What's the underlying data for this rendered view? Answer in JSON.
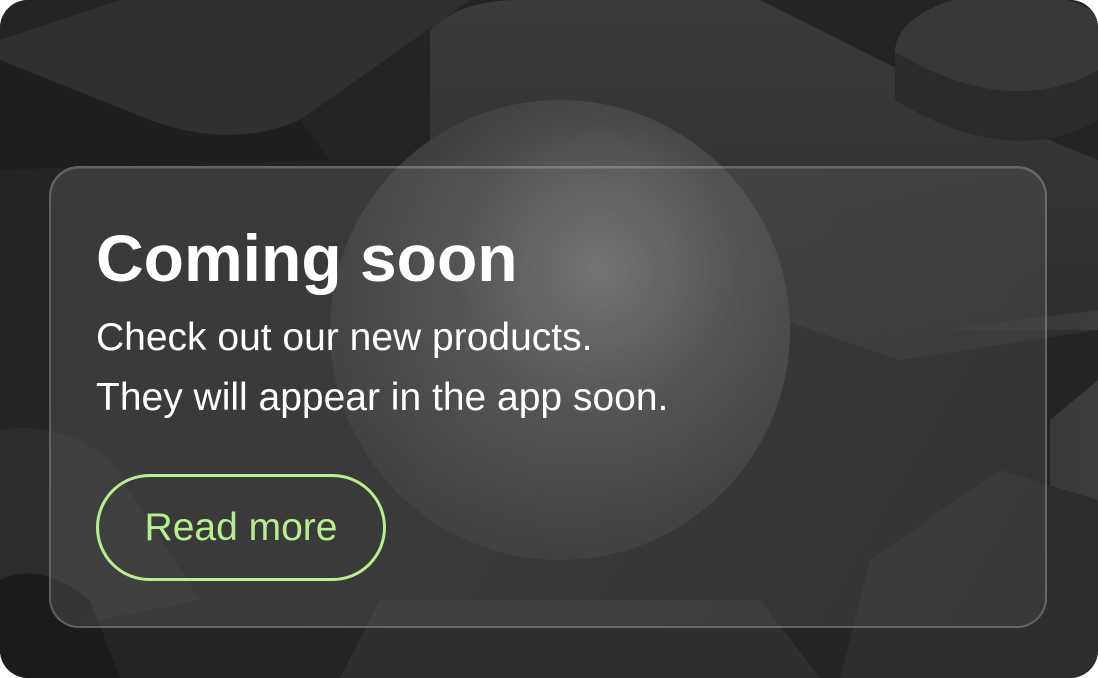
{
  "card": {
    "title": "Coming soon",
    "description_lines": [
      "Check out our new products.",
      "They will appear in the app soon."
    ],
    "button_label": "Read more"
  },
  "colors": {
    "background": "#262626",
    "accent": "#b6f08e",
    "text": "#ffffff"
  }
}
